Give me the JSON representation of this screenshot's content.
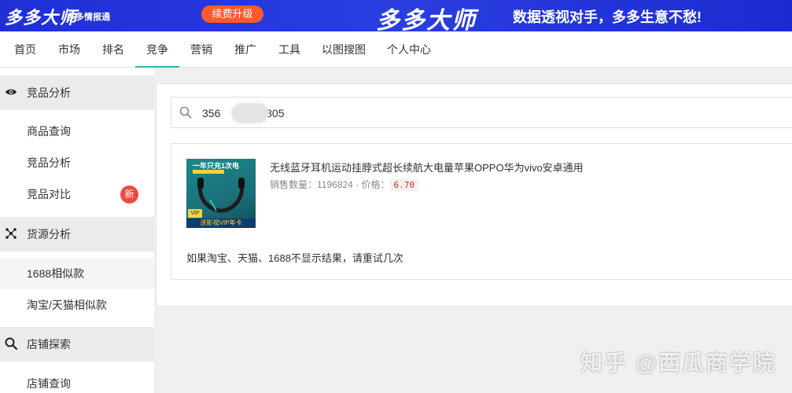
{
  "banner": {
    "logo": "多多大师",
    "logo_sub": "多多情报通",
    "renew_label": "续费升级",
    "brand": "多多大师",
    "slogan": "数据透视对手，多多生意不愁!"
  },
  "nav": {
    "items": [
      "首页",
      "市场",
      "排名",
      "竞争",
      "营销",
      "推广",
      "工具",
      "以图搜图",
      "个人中心"
    ],
    "active": "竞争"
  },
  "sidebar": {
    "groups": [
      {
        "label": "竞品分析",
        "icon": "eye-icon"
      },
      {
        "label": "货源分析",
        "icon": "network-icon"
      },
      {
        "label": "店铺探索",
        "icon": "search-icon"
      }
    ],
    "items": [
      "商品查询",
      "竞品分析",
      "竞品对比",
      "1688相似款",
      "淘宝/天猫相似款",
      "店铺查询"
    ],
    "new_badge": "新",
    "selected": "1688相似款"
  },
  "search": {
    "value_prefix": "356",
    "value_suffix": "2305"
  },
  "result": {
    "title": "无线蓝牙耳机运动挂脖式超长续航大电量苹果OPPO华为vivo安卓通用",
    "sales_label": "销售数量：",
    "sales_value": "1196824",
    "price_label": "价格：",
    "price_value": "6.70",
    "thumb_top": "一年只充1次电",
    "thumb_bottom": "送影视VIP年卡",
    "thumb_vip": "VIP"
  },
  "hint": "如果淘宝、天猫、1688不显示结果，请重试几次",
  "watermark": "知乎 @西瓜商学院",
  "colors": {
    "banner_bg": "#1f2fd6",
    "renew_btn": "#ff5a2c",
    "nav_active": "#2bb3a8",
    "badge": "#f04a3e"
  }
}
